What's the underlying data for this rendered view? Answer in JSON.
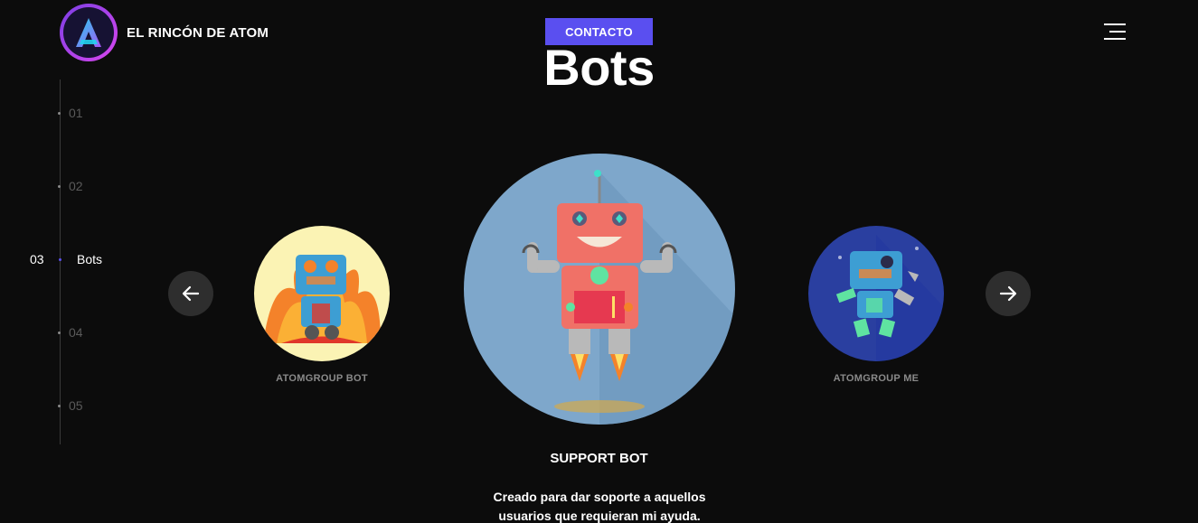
{
  "header": {
    "brand_name": "EL RINCÓN DE ATOM",
    "contact_label": "CONTACTO",
    "title": "Bots"
  },
  "side_nav": {
    "items": [
      {
        "num": "01",
        "label": ""
      },
      {
        "num": "02",
        "label": ""
      },
      {
        "num": "03",
        "label": "Bots"
      },
      {
        "num": "04",
        "label": ""
      },
      {
        "num": "05",
        "label": ""
      }
    ]
  },
  "carousel": {
    "left_bot": {
      "name": "ATOMGROUP BOT",
      "bg": "#fbf3b4"
    },
    "center_bot": {
      "name": "SUPPORT BOT",
      "description": "Creado para dar soporte a aquellos usuarios que requieran mi ayuda.",
      "bg": "#7ea7cb"
    },
    "right_bot": {
      "name": "ATOMGROUP ME",
      "bg": "#2a3fa0"
    }
  },
  "colors": {
    "accent": "#5a4ff0",
    "background": "#0c0c0c"
  },
  "icons": {
    "prev": "arrow-left-icon",
    "next": "arrow-right-icon",
    "menu": "hamburger-icon"
  }
}
